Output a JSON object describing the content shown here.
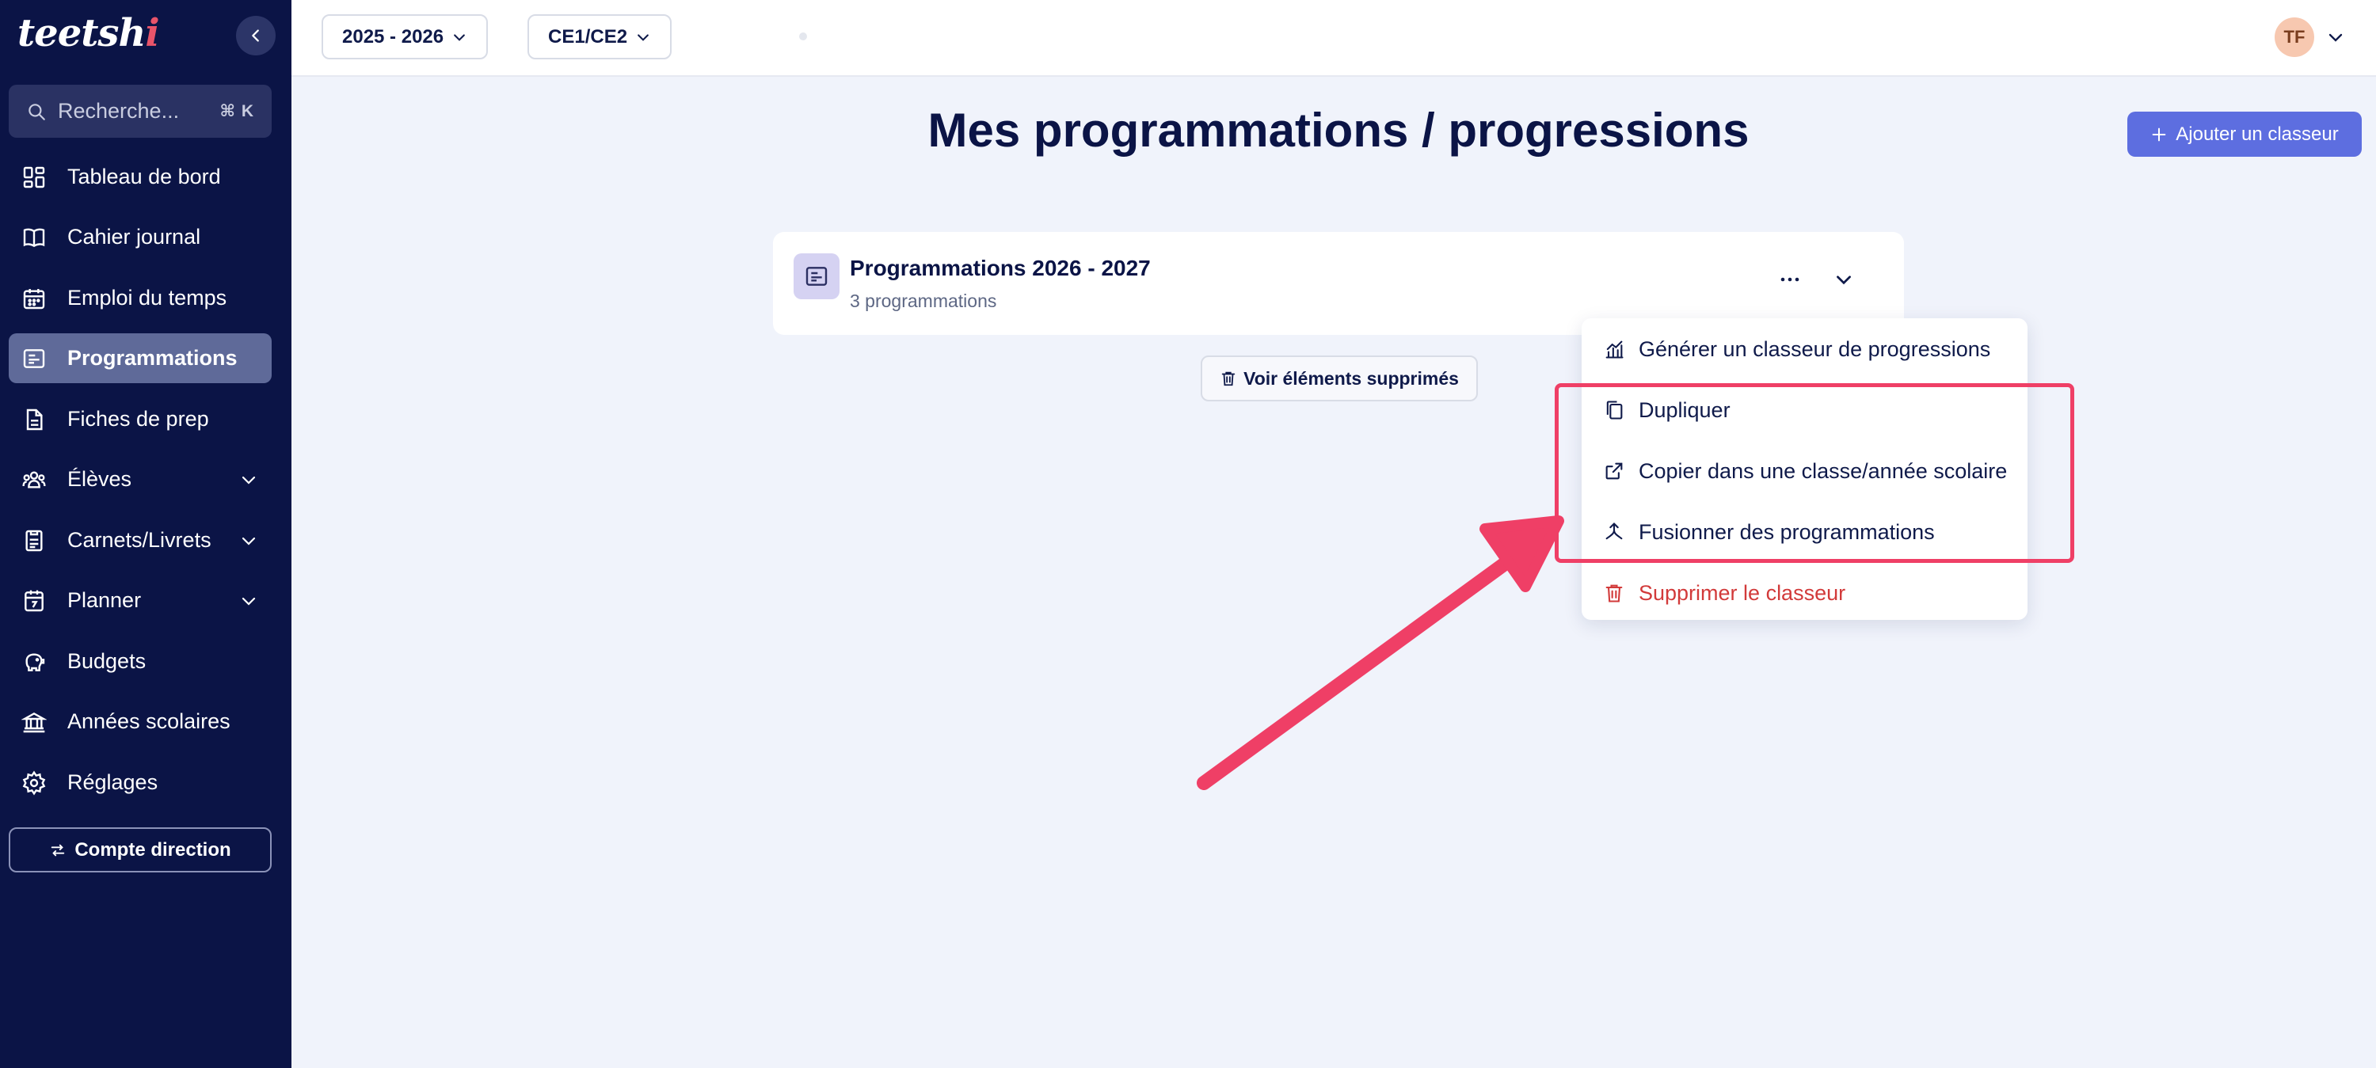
{
  "sidebar": {
    "logo_text": "teetsh",
    "logo_accent": "i",
    "search_placeholder": "Recherche...",
    "search_shortcut": "⌘ K",
    "items": [
      {
        "label": "Tableau de bord",
        "icon": "dashboard-icon",
        "active": false,
        "has_chevron": false
      },
      {
        "label": "Cahier journal",
        "icon": "book-icon",
        "active": false,
        "has_chevron": false
      },
      {
        "label": "Emploi du temps",
        "icon": "calendar-icon",
        "active": false,
        "has_chevron": false
      },
      {
        "label": "Programmations",
        "icon": "programmations-icon",
        "active": true,
        "has_chevron": false
      },
      {
        "label": "Fiches de prep",
        "icon": "document-icon",
        "active": false,
        "has_chevron": false
      },
      {
        "label": "Élèves",
        "icon": "students-icon",
        "active": false,
        "has_chevron": true
      },
      {
        "label": "Carnets/Livrets",
        "icon": "notebook-icon",
        "active": false,
        "has_chevron": true
      },
      {
        "label": "Planner",
        "icon": "planner-icon",
        "active": false,
        "has_chevron": true
      },
      {
        "label": "Budgets",
        "icon": "piggy-bank-icon",
        "active": false,
        "has_chevron": false
      },
      {
        "label": "Années scolaires",
        "icon": "school-icon",
        "active": false,
        "has_chevron": false
      },
      {
        "label": "Réglages",
        "icon": "gear-icon",
        "active": false,
        "has_chevron": false
      }
    ],
    "direction_button": "Compte direction"
  },
  "topbar": {
    "year_select": "2025 - 2026",
    "class_select": "CE1/CE2",
    "avatar_initials": "TF"
  },
  "main": {
    "title": "Mes programmations / progressions",
    "add_button": "Ajouter un classeur",
    "card": {
      "title": "Programmations 2026 - 2027",
      "subtitle": "3 programmations"
    },
    "deleted_button": "Voir éléments supprimés"
  },
  "menu": {
    "items": [
      {
        "label": "Générer un classeur de progressions",
        "icon": "chart-icon"
      },
      {
        "label": "Dupliquer",
        "icon": "duplicate-icon"
      },
      {
        "label": "Copier dans une classe/année scolaire",
        "icon": "external-link-icon"
      },
      {
        "label": "Fusionner des programmations",
        "icon": "merge-icon"
      },
      {
        "label": "Supprimer le classeur",
        "icon": "trash-icon"
      }
    ]
  },
  "colors": {
    "sidebar_bg": "#0b1446",
    "accent": "#5d6ee0",
    "highlight": "#ef3f66",
    "danger": "#d23a3a"
  }
}
